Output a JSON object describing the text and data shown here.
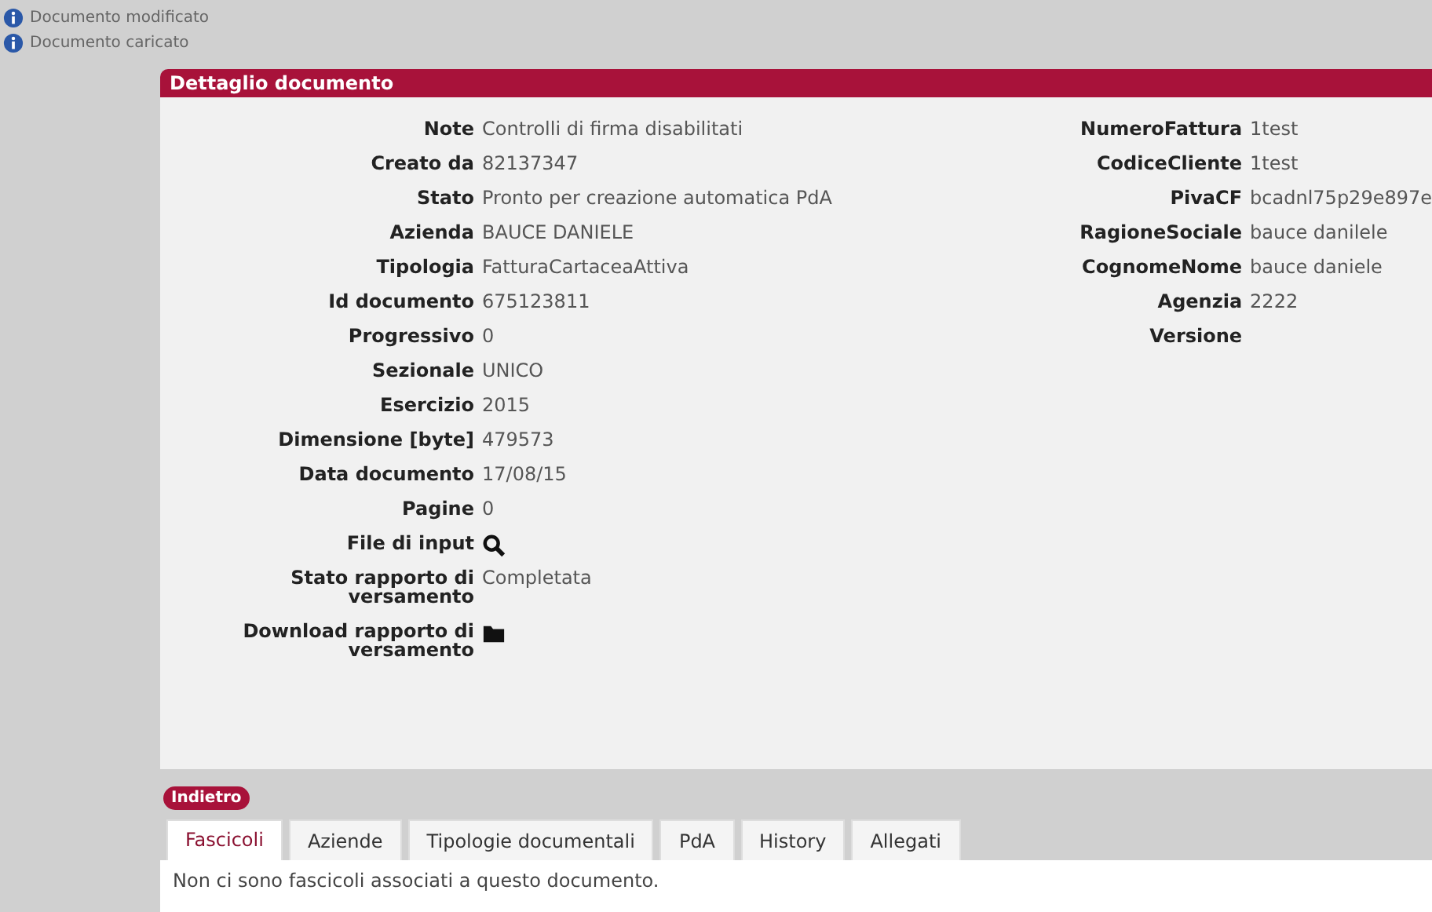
{
  "messages": [
    {
      "text": "Documento modificato"
    },
    {
      "text": "Documento caricato"
    }
  ],
  "panel": {
    "title": "Dettaglio documento"
  },
  "left_fields": [
    {
      "label": "Note",
      "kind": "text",
      "value": "Controlli di firma disabilitati"
    },
    {
      "label": "Creato da",
      "kind": "text",
      "value": "82137347"
    },
    {
      "label": "Stato",
      "kind": "text",
      "value": "Pronto per creazione automatica PdA"
    },
    {
      "label": "Azienda",
      "kind": "text",
      "value": "BAUCE DANIELE"
    },
    {
      "label": "Tipologia",
      "kind": "text",
      "value": "FatturaCartaceaAttiva"
    },
    {
      "label": "Id documento",
      "kind": "text",
      "value": "675123811"
    },
    {
      "label": "Progressivo",
      "kind": "text",
      "value": "0"
    },
    {
      "label": "Sezionale",
      "kind": "text",
      "value": "UNICO"
    },
    {
      "label": "Esercizio",
      "kind": "text",
      "value": "2015"
    },
    {
      "label": "Dimensione [byte]",
      "kind": "text",
      "value": "479573"
    },
    {
      "label": "Data documento",
      "kind": "text",
      "value": "17/08/15"
    },
    {
      "label": "Pagine",
      "kind": "text",
      "value": "0"
    },
    {
      "label": "File di input",
      "kind": "search"
    },
    {
      "label": "Stato rapporto di versamento",
      "kind": "text",
      "value": "Completata"
    },
    {
      "label": "Download rapporto di versamento",
      "kind": "folder"
    }
  ],
  "right_fields": [
    {
      "label": "NumeroFattura",
      "value": "1test"
    },
    {
      "label": "CodiceCliente",
      "value": "1test"
    },
    {
      "label": "PivaCF",
      "value": "bcadnl75p29e897e"
    },
    {
      "label": "RagioneSociale",
      "value": "bauce danilele"
    },
    {
      "label": "CognomeNome",
      "value": "bauce daniele"
    },
    {
      "label": "Agenzia",
      "value": "2222"
    },
    {
      "label": "Versione"
    }
  ],
  "back_button": "Indietro",
  "tabs": [
    {
      "label": "Fascicoli",
      "selected": true
    },
    {
      "label": "Aziende",
      "selected": false
    },
    {
      "label": "Tipologie documentali",
      "selected": false
    },
    {
      "label": "PdA",
      "selected": false
    },
    {
      "label": "History",
      "selected": false
    },
    {
      "label": "Allegati",
      "selected": false
    }
  ],
  "tab_content": "Non ci sono fascicoli associati a questo documento."
}
